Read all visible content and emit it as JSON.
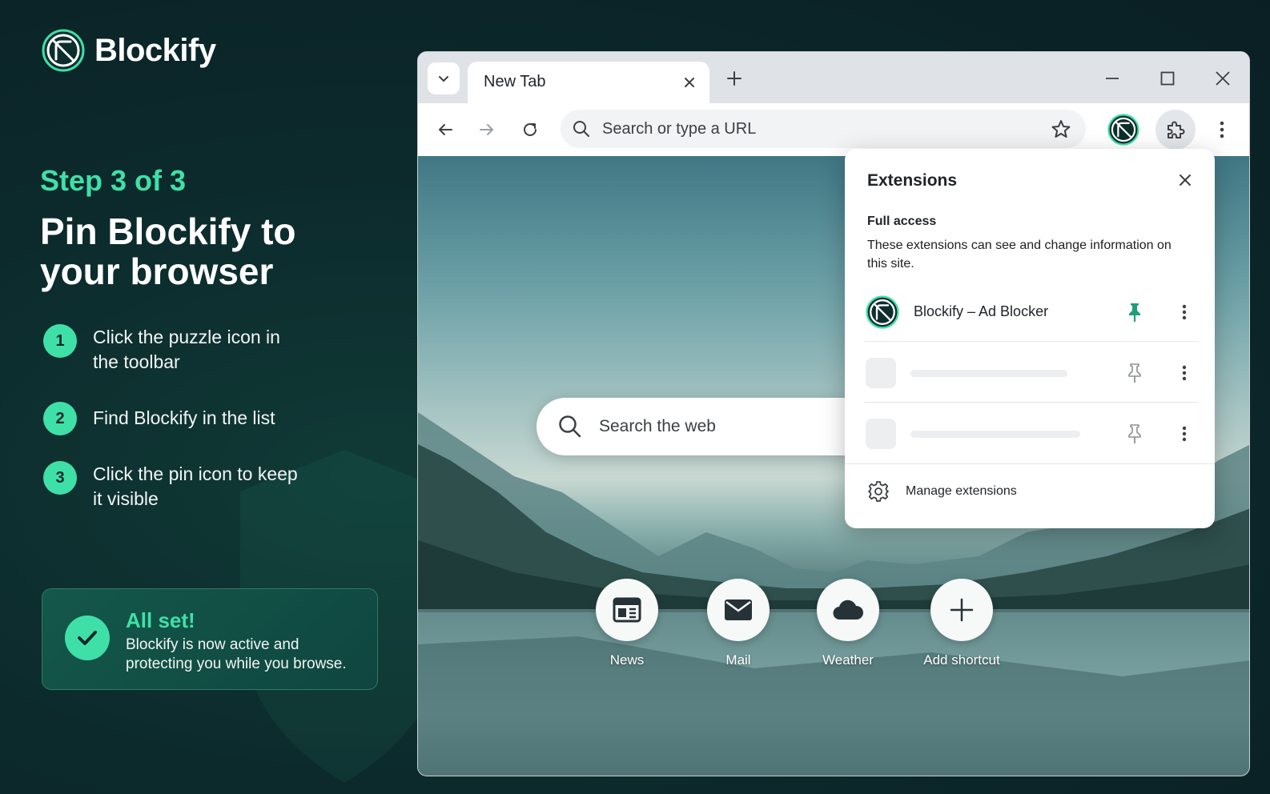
{
  "brand": {
    "name": "Blockify"
  },
  "onboarding": {
    "step_label": "Step 3 of 3",
    "headline": "Pin Blockify to your browser",
    "steps": [
      {
        "num": "1",
        "text": "Click the puzzle icon in the toolbar"
      },
      {
        "num": "2",
        "text": "Find Blockify in the list"
      },
      {
        "num": "3",
        "text": "Click the pin icon to keep it visible"
      }
    ],
    "done": {
      "title": "All set!",
      "desc": "Blockify is now active and protecting you while you browse."
    }
  },
  "browser": {
    "tab_title": "New Tab",
    "omnibox_placeholder": "Search or type a URL",
    "ntp_search_placeholder": "Search the web",
    "shortcuts": [
      {
        "label": "News",
        "icon": "news-icon"
      },
      {
        "label": "Mail",
        "icon": "mail-icon"
      },
      {
        "label": "Weather",
        "icon": "cloud-icon"
      },
      {
        "label": "Add shortcut",
        "icon": "plus-icon"
      }
    ]
  },
  "extensions_popup": {
    "title": "Extensions",
    "section_title": "Full access",
    "section_desc": "These extensions can see and change information on this site.",
    "items": [
      {
        "name": "Blockify – Ad Blocker",
        "pinned": true
      }
    ],
    "manage_label": "Manage extensions"
  },
  "colors": {
    "accent": "#3fe0a8",
    "background": "#0c2a2c",
    "pin_active": "#1f9e78"
  }
}
